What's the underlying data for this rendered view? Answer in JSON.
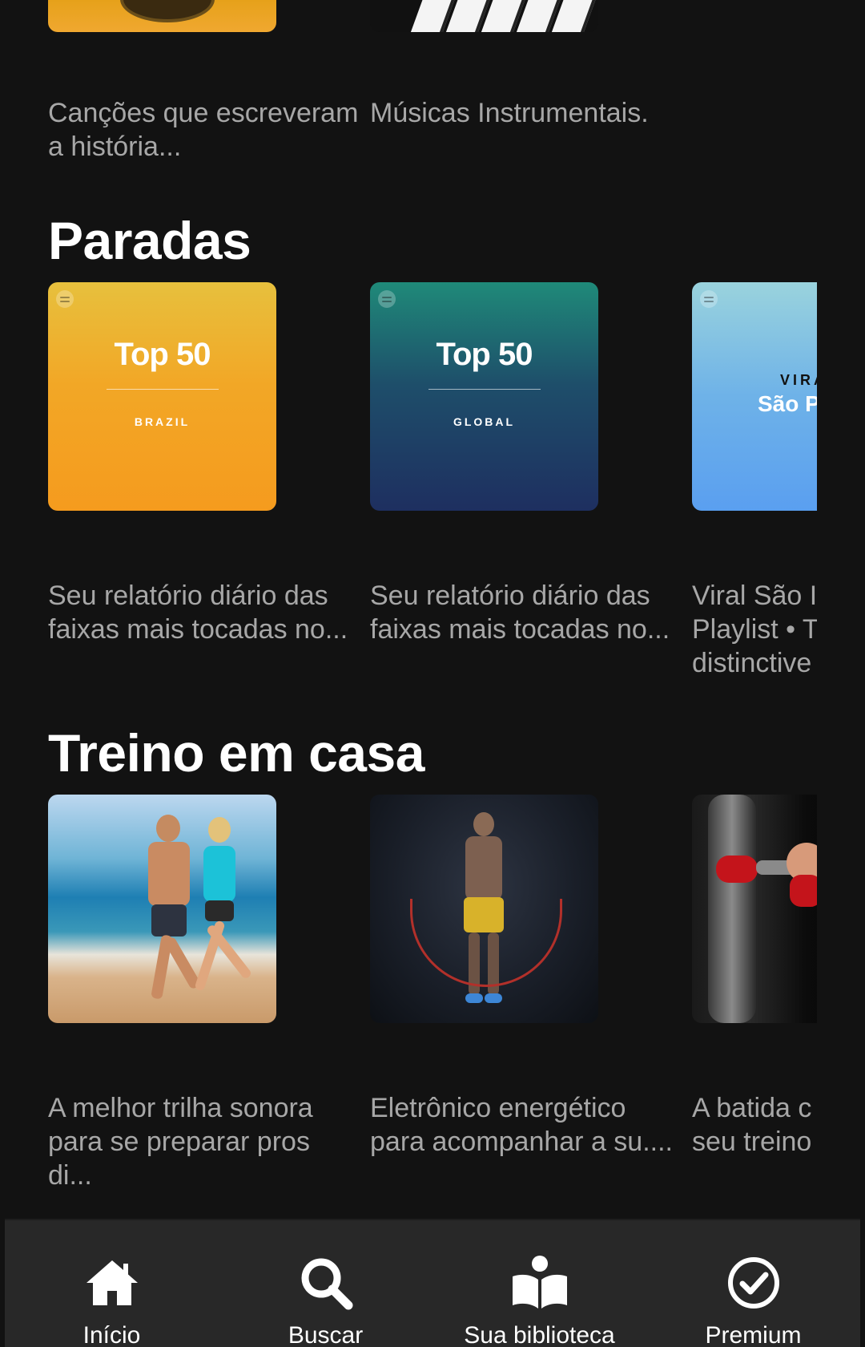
{
  "top_row": {
    "items": [
      {
        "description": "Canções que escreveram a história..."
      },
      {
        "description": "Músicas Instrumentais."
      }
    ]
  },
  "sections": [
    {
      "title": "Paradas",
      "cards": [
        {
          "cover_title": "Top 50",
          "cover_subtitle": "BRAZIL",
          "description": "Seu relatório diário das faixas mais tocadas no..."
        },
        {
          "cover_title": "Top 50",
          "cover_subtitle": "GLOBAL",
          "description": "Seu relatório diário das faixas mais tocadas no..."
        },
        {
          "cover_title": "VIRA",
          "cover_subtitle": "São Pa",
          "description": "Viral São I Playlist • T distinctive"
        }
      ]
    },
    {
      "title": "Treino em casa",
      "cards": [
        {
          "description": "A melhor trilha sonora para se preparar pros di..."
        },
        {
          "description": "Eletrônico energético para acompanhar a su...."
        },
        {
          "description": "A batida c seu treino"
        }
      ]
    }
  ],
  "bottom_nav": [
    {
      "label": "Início",
      "icon": "home-icon"
    },
    {
      "label": "Buscar",
      "icon": "search-icon"
    },
    {
      "label": "Sua biblioteca",
      "icon": "library-icon"
    },
    {
      "label": "Premium",
      "icon": "premium-icon"
    }
  ],
  "colors": {
    "background": "#121212",
    "nav_background": "#282828",
    "secondary_text": "#a7a7a7"
  }
}
